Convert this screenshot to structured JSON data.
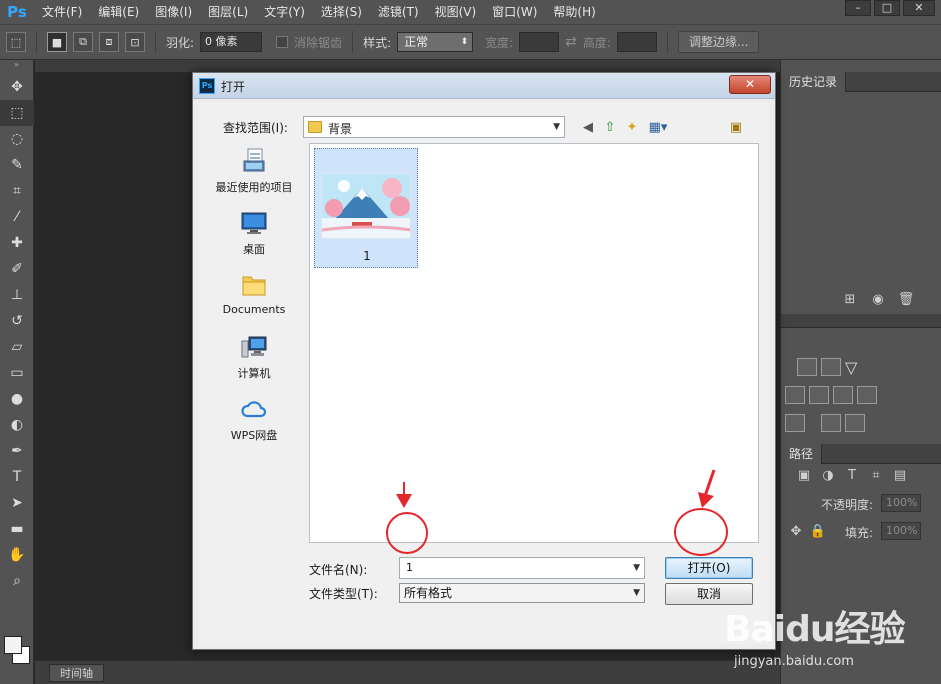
{
  "app": {
    "logo": "Ps",
    "menus": [
      "文件(F)",
      "编辑(E)",
      "图像(I)",
      "图层(L)",
      "文字(Y)",
      "选择(S)",
      "滤镜(T)",
      "视图(V)",
      "窗口(W)",
      "帮助(H)"
    ],
    "window_controls": [
      "–",
      "□",
      "✕"
    ]
  },
  "options_bar": {
    "feather_label": "羽化:",
    "feather_value": "0 像素",
    "antialias_label": "消除锯齿",
    "style_label": "样式:",
    "style_value": "正常",
    "width_label": "宽度:",
    "height_label": "高度:",
    "refine_edge_label": "调整边缘..."
  },
  "timeline": {
    "tab_label": "时间轴"
  },
  "right_panel": {
    "history_tab": "历史记录",
    "paths_tab": "路径",
    "opacity_label": "不透明度:",
    "opacity_value": "100%",
    "fill_label": "填充:",
    "fill_value": "100%"
  },
  "dialog": {
    "title": "打开",
    "close_label": "✕",
    "lookin_label": "查找范围(I):",
    "lookin_value": "背景",
    "places": [
      {
        "label": "最近使用的项目",
        "icon": "recent-items-icon"
      },
      {
        "label": "桌面",
        "icon": "desktop-icon"
      },
      {
        "label": "Documents",
        "icon": "folder-icon"
      },
      {
        "label": "计算机",
        "icon": "computer-icon"
      },
      {
        "label": "WPS网盘",
        "icon": "cloud-icon"
      }
    ],
    "files": [
      {
        "name": "1"
      }
    ],
    "filename_label": "文件名(N):",
    "filename_value": "1",
    "filetype_label": "文件类型(T):",
    "filetype_value": "所有格式",
    "open_button": "打开(O)",
    "cancel_button": "取消"
  },
  "watermark": {
    "main": "Baidu经验",
    "sub": "jingyan.baidu.com"
  },
  "colors": {
    "ps_chrome": "#535353",
    "ps_canvas": "#282828",
    "dialog_title": "#c4d3e6",
    "annotation_red": "#e3272b",
    "selection_blue": "#cfe3fb"
  }
}
